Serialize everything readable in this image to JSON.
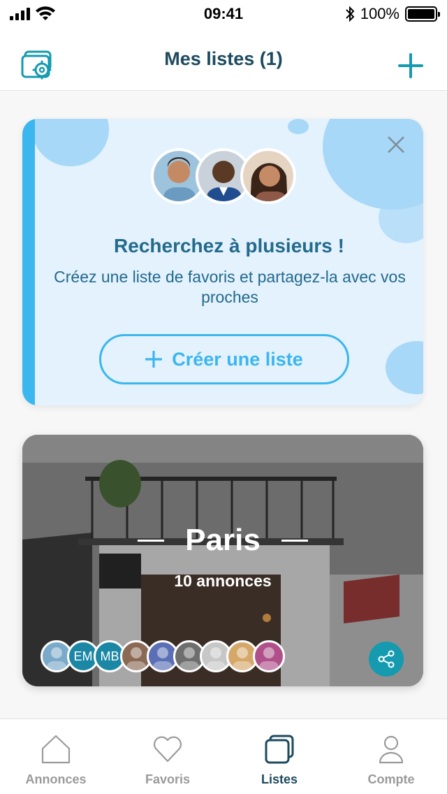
{
  "status_bar": {
    "time": "09:41",
    "battery": "100%"
  },
  "header": {
    "title": "Mes listes (1)",
    "settings_icon": "folder-settings-icon",
    "add_icon": "plus-icon"
  },
  "promo": {
    "title": "Recherchez à plusieurs !",
    "text": "Créez une liste de favoris et partagez-la avec vos proches",
    "button_label": "Créer une liste",
    "close_icon": "close-icon"
  },
  "list_card": {
    "name": "Paris",
    "count": "10 annonces",
    "members": [
      {
        "initials": "",
        "color": "#7aa9c9"
      },
      {
        "initials": "EM",
        "color": "#1b87a5"
      },
      {
        "initials": "MB",
        "color": "#1b87a5"
      },
      {
        "initials": "",
        "color": "#8a6a55"
      },
      {
        "initials": "",
        "color": "#5a6fb5"
      },
      {
        "initials": "",
        "color": "#6e6e6e"
      },
      {
        "initials": "",
        "color": "#c7c7c7"
      },
      {
        "initials": "",
        "color": "#d5a86a"
      },
      {
        "initials": "",
        "color": "#b0508a"
      }
    ],
    "share_icon": "share-icon"
  },
  "tabs": [
    {
      "label": "Annonces",
      "icon": "home-icon",
      "active": false
    },
    {
      "label": "Favoris",
      "icon": "heart-icon",
      "active": false
    },
    {
      "label": "Listes",
      "icon": "lists-icon",
      "active": true
    },
    {
      "label": "Compte",
      "icon": "user-icon",
      "active": false
    }
  ],
  "colors": {
    "accent": "#3bb6ee",
    "title": "#1c4a5e",
    "promo_text": "#236a8c",
    "share": "#159ab0"
  }
}
